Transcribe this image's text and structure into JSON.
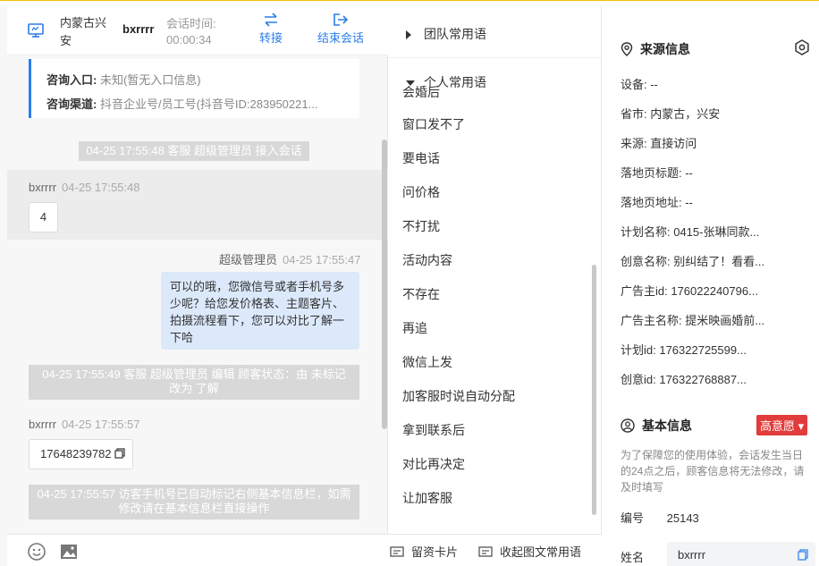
{
  "header": {
    "location": "内蒙古兴安",
    "customer": "bxrrrr",
    "session_label": "会话时间:",
    "session_time": "00:00:34",
    "transfer": "转接",
    "end": "结束会话"
  },
  "info_card": {
    "entry_label": "咨询入口:",
    "entry_value": "未知(暂无入口信息)",
    "channel_label": "咨询渠道:",
    "channel_value": "抖音企业号/员工号(抖音号ID:283950221..."
  },
  "messages": {
    "sys1": "04-25 17:55:48 客服 超级管理员 接入会话",
    "guest1_name": "bxrrrr",
    "guest1_time": "04-25 17:55:48",
    "guest1_text": "4",
    "agent_name": "超级管理员",
    "agent_time": "04-25 17:55:47",
    "agent_text": "可以的哦，您微信号或者手机号多少呢？给您发价格表、主题客片、拍摄流程看下，您可以对比了解一下哈",
    "sys2": "04-25 17:55:49 客服 超级管理员 编辑 顾客状态：由 未标记 改为 了解",
    "guest2_name": "bxrrrr",
    "guest2_time": "04-25 17:55:57",
    "guest2_text": "17648239782",
    "sys3": "04-25 17:55:57 访客手机号已自动标记右侧基本信息栏，如需修改请在基本信息栏直接操作"
  },
  "phrases": {
    "team_group": "团队常用语",
    "personal_group": "个人常用语",
    "partial_item": "会婚后",
    "items": [
      "窗口发不了",
      "要电话",
      "问价格",
      "不打扰",
      "活动内容",
      "不存在",
      "再追",
      "微信上发",
      "加客服时说自动分配",
      "拿到联系后",
      "对比再决定",
      "让加客服"
    ],
    "card": "留资卡片",
    "collect": "收起图文常用语"
  },
  "source": {
    "title": "来源信息",
    "rows": [
      "设备: --",
      "省市: 内蒙古，兴安",
      "来源: 直接访问",
      "落地页标题: --",
      "落地页地址: --",
      "计划名称: 0415-张琳同款...",
      "创意名称: 别纠结了！看看...",
      "广告主id: 176022240796...",
      "广告主名称: 提米映画婚前...",
      "计划id: 176322725599...",
      "创意id: 176322768887..."
    ]
  },
  "basic": {
    "title": "基本信息",
    "intent": "高意愿 ▾",
    "hint": "为了保障您的使用体验，会话发生当日的24点之后，顾客信息将无法修改，请及时填写",
    "number_label": "编号",
    "number_value": "25143",
    "name_label": "姓名",
    "name_value": "bxrrrr"
  },
  "colors": {
    "accent": "#2b7de9",
    "badge": "#e23b3b",
    "agent_bubble": "#dce9fb"
  }
}
